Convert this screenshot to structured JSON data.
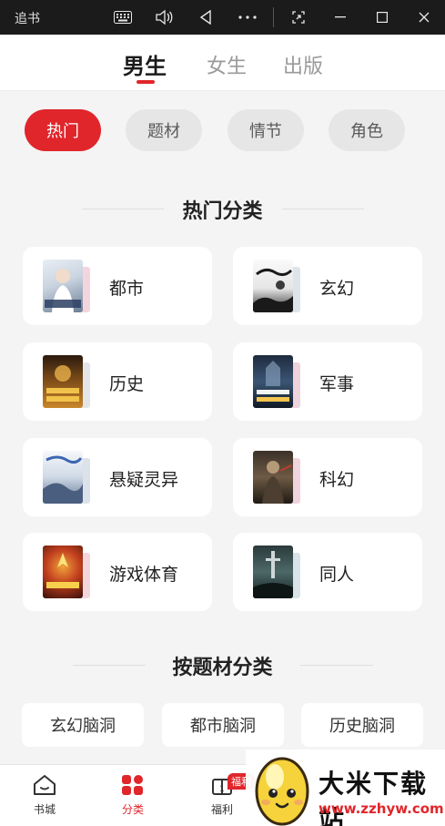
{
  "window": {
    "title": "追书",
    "controls": [
      "keyboard-icon",
      "volume-icon",
      "back-icon",
      "more-icon",
      "screenshot-icon",
      "minimize-icon",
      "maximize-icon",
      "close-icon"
    ]
  },
  "top_tabs": [
    {
      "label": "男生",
      "active": true
    },
    {
      "label": "女生",
      "active": false
    },
    {
      "label": "出版",
      "active": false
    }
  ],
  "filters": [
    {
      "label": "热门",
      "active": true
    },
    {
      "label": "题材",
      "active": false
    },
    {
      "label": "情节",
      "active": false
    },
    {
      "label": "角色",
      "active": false
    }
  ],
  "hot_section": {
    "title": "热门分类",
    "categories": [
      {
        "label": "都市"
      },
      {
        "label": "玄幻"
      },
      {
        "label": "历史"
      },
      {
        "label": "军事"
      },
      {
        "label": "悬疑灵异"
      },
      {
        "label": "科幻"
      },
      {
        "label": "游戏体育"
      },
      {
        "label": "同人"
      }
    ]
  },
  "subject_section": {
    "title": "按题材分类",
    "items": [
      "玄幻脑洞",
      "都市脑洞",
      "历史脑洞"
    ]
  },
  "bottom_nav": [
    {
      "label": "书城",
      "icon": "home-icon",
      "active": false
    },
    {
      "label": "分类",
      "icon": "category-icon",
      "active": true
    },
    {
      "label": "福利",
      "icon": "gift-icon",
      "active": false,
      "badge": "福利"
    }
  ],
  "watermark": {
    "name": "大米下载站",
    "url": "www.zzhyw.com"
  },
  "colors": {
    "accent": "#e0262b",
    "background": "#f4f4f4",
    "titlebar": "#1b1b1b"
  }
}
